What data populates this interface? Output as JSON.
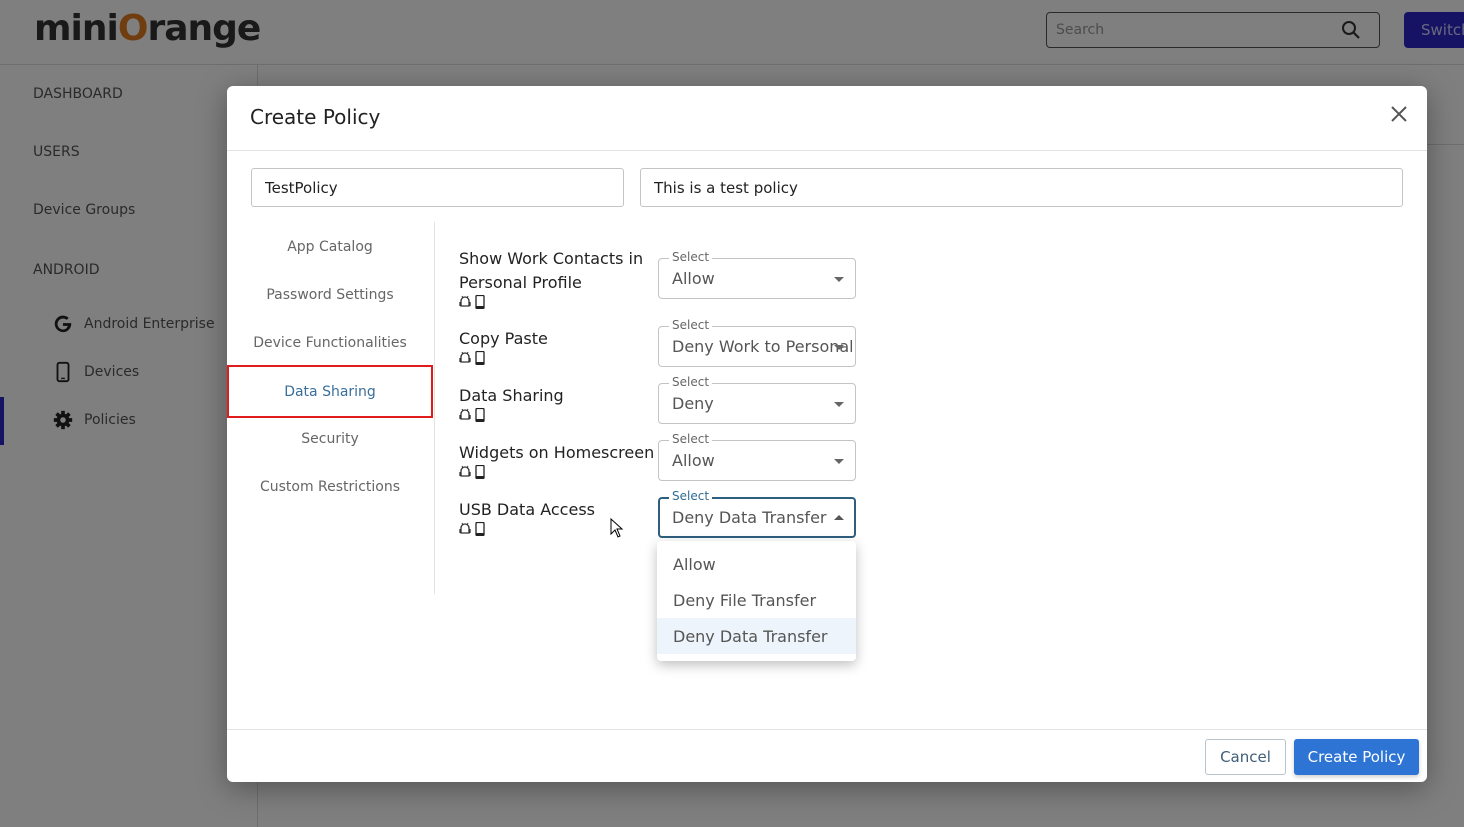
{
  "app": {
    "logo_text_1": "mini",
    "logo_text_o": "O",
    "logo_text_2": "range",
    "search_placeholder": "Search",
    "switch_label": "Switch"
  },
  "sidebar": {
    "items": [
      {
        "label": "DASHBOARD"
      },
      {
        "label": "USERS"
      },
      {
        "label": "Device Groups"
      },
      {
        "label": "ANDROID"
      }
    ],
    "sub_items": [
      {
        "label": "Android Enterprise",
        "icon": "google-icon"
      },
      {
        "label": "Devices",
        "icon": "phone-icon"
      },
      {
        "label": "Policies",
        "icon": "gear-icon"
      }
    ]
  },
  "modal": {
    "title": "Create Policy",
    "policy_name": "TestPolicy",
    "policy_description": "This is a test policy",
    "tabs": [
      {
        "label": "App Catalog"
      },
      {
        "label": "Password Settings"
      },
      {
        "label": "Device Functionalities"
      },
      {
        "label": "Data Sharing",
        "active": true
      },
      {
        "label": "Security"
      },
      {
        "label": "Custom Restrictions"
      }
    ],
    "settings": [
      {
        "label": "Show Work Contacts in Personal Profile",
        "select_label": "Select",
        "value": "Allow"
      },
      {
        "label": "Copy Paste",
        "select_label": "Select",
        "value": "Deny Work to Personal"
      },
      {
        "label": "Data Sharing",
        "select_label": "Select",
        "value": "Deny"
      },
      {
        "label": "Widgets on Homescreen",
        "select_label": "Select",
        "value": "Allow"
      },
      {
        "label": "USB Data Access",
        "select_label": "Select",
        "value": "Deny Data Transfer"
      }
    ],
    "usb_dropdown_options": [
      "Allow",
      "Deny File Transfer",
      "Deny Data Transfer"
    ],
    "usb_dropdown_selected": "Deny Data Transfer",
    "cancel_label": "Cancel",
    "create_label": "Create Policy"
  },
  "colors": {
    "primary": "#2d74d5",
    "brand_purple": "#2f27c8",
    "logo_orange": "#e07b22",
    "active_tab_border": "#e01b1b",
    "active_tab_text": "#3a6f9a"
  }
}
